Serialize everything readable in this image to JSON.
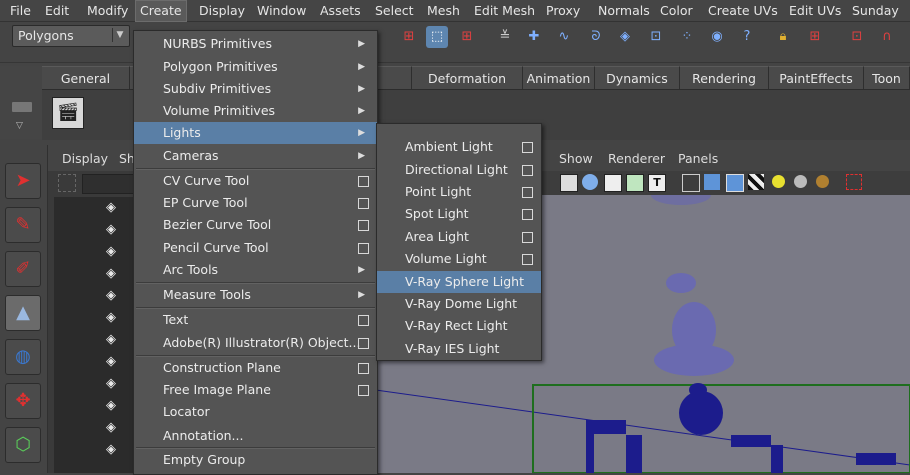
{
  "menubar": {
    "items": [
      "File",
      "Edit",
      "Modify",
      "Create",
      "Display",
      "Window",
      "Assets",
      "Select",
      "Mesh",
      "Edit Mesh",
      "Proxy",
      "Normals",
      "Color",
      "Create UVs",
      "Edit UVs",
      "Sunday"
    ]
  },
  "statusline": {
    "mode": "Polygons"
  },
  "shelf": {
    "tabs": [
      "General",
      "C",
      "divs",
      "Deformation",
      "Animation",
      "Dynamics",
      "Rendering",
      "PaintEffects",
      "Toon"
    ]
  },
  "outliner": {
    "menu": [
      "Display",
      "Sh"
    ]
  },
  "viewport": {
    "menu": [
      "Show",
      "Renderer",
      "Panels"
    ]
  },
  "create_menu": {
    "items": [
      {
        "label": "NURBS Primitives",
        "kind": "submenu"
      },
      {
        "label": "Polygon Primitives",
        "kind": "submenu"
      },
      {
        "label": "Subdiv Primitives",
        "kind": "submenu"
      },
      {
        "label": "Volume Primitives",
        "kind": "submenu"
      },
      {
        "label": "Lights",
        "kind": "submenu",
        "highlighted": true
      },
      {
        "label": "Cameras",
        "kind": "submenu"
      },
      {
        "label": "CV Curve Tool",
        "kind": "option"
      },
      {
        "label": "EP Curve Tool",
        "kind": "option"
      },
      {
        "label": "Bezier Curve Tool",
        "kind": "option"
      },
      {
        "label": "Pencil Curve Tool",
        "kind": "option"
      },
      {
        "label": "Arc Tools",
        "kind": "submenu"
      },
      {
        "label": "Measure Tools",
        "kind": "submenu"
      },
      {
        "label": "Text",
        "kind": "option"
      },
      {
        "label": "Adobe(R) Illustrator(R) Object...",
        "kind": "option"
      },
      {
        "label": "Construction Plane",
        "kind": "option"
      },
      {
        "label": "Free Image Plane",
        "kind": "option"
      },
      {
        "label": "Locator",
        "kind": "plain"
      },
      {
        "label": "Annotation...",
        "kind": "plain"
      },
      {
        "label": "Empty Group",
        "kind": "plain"
      }
    ]
  },
  "lights_submenu": {
    "items": [
      {
        "label": "Ambient Light",
        "kind": "option"
      },
      {
        "label": "Directional Light",
        "kind": "option"
      },
      {
        "label": "Point Light",
        "kind": "option"
      },
      {
        "label": "Spot Light",
        "kind": "option"
      },
      {
        "label": "Area Light",
        "kind": "option"
      },
      {
        "label": "Volume Light",
        "kind": "option"
      },
      {
        "label": "V-Ray Sphere Light",
        "kind": "plain",
        "highlighted": true
      },
      {
        "label": "V-Ray Dome Light",
        "kind": "plain"
      },
      {
        "label": "V-Ray Rect Light",
        "kind": "plain"
      },
      {
        "label": "V-Ray IES Light",
        "kind": "plain"
      }
    ]
  },
  "colors": {
    "highlight": "#5a7fa6",
    "menu_bg": "#545454",
    "viewport_bg": "#7a7a86",
    "mesh": "#1c1c8c"
  }
}
